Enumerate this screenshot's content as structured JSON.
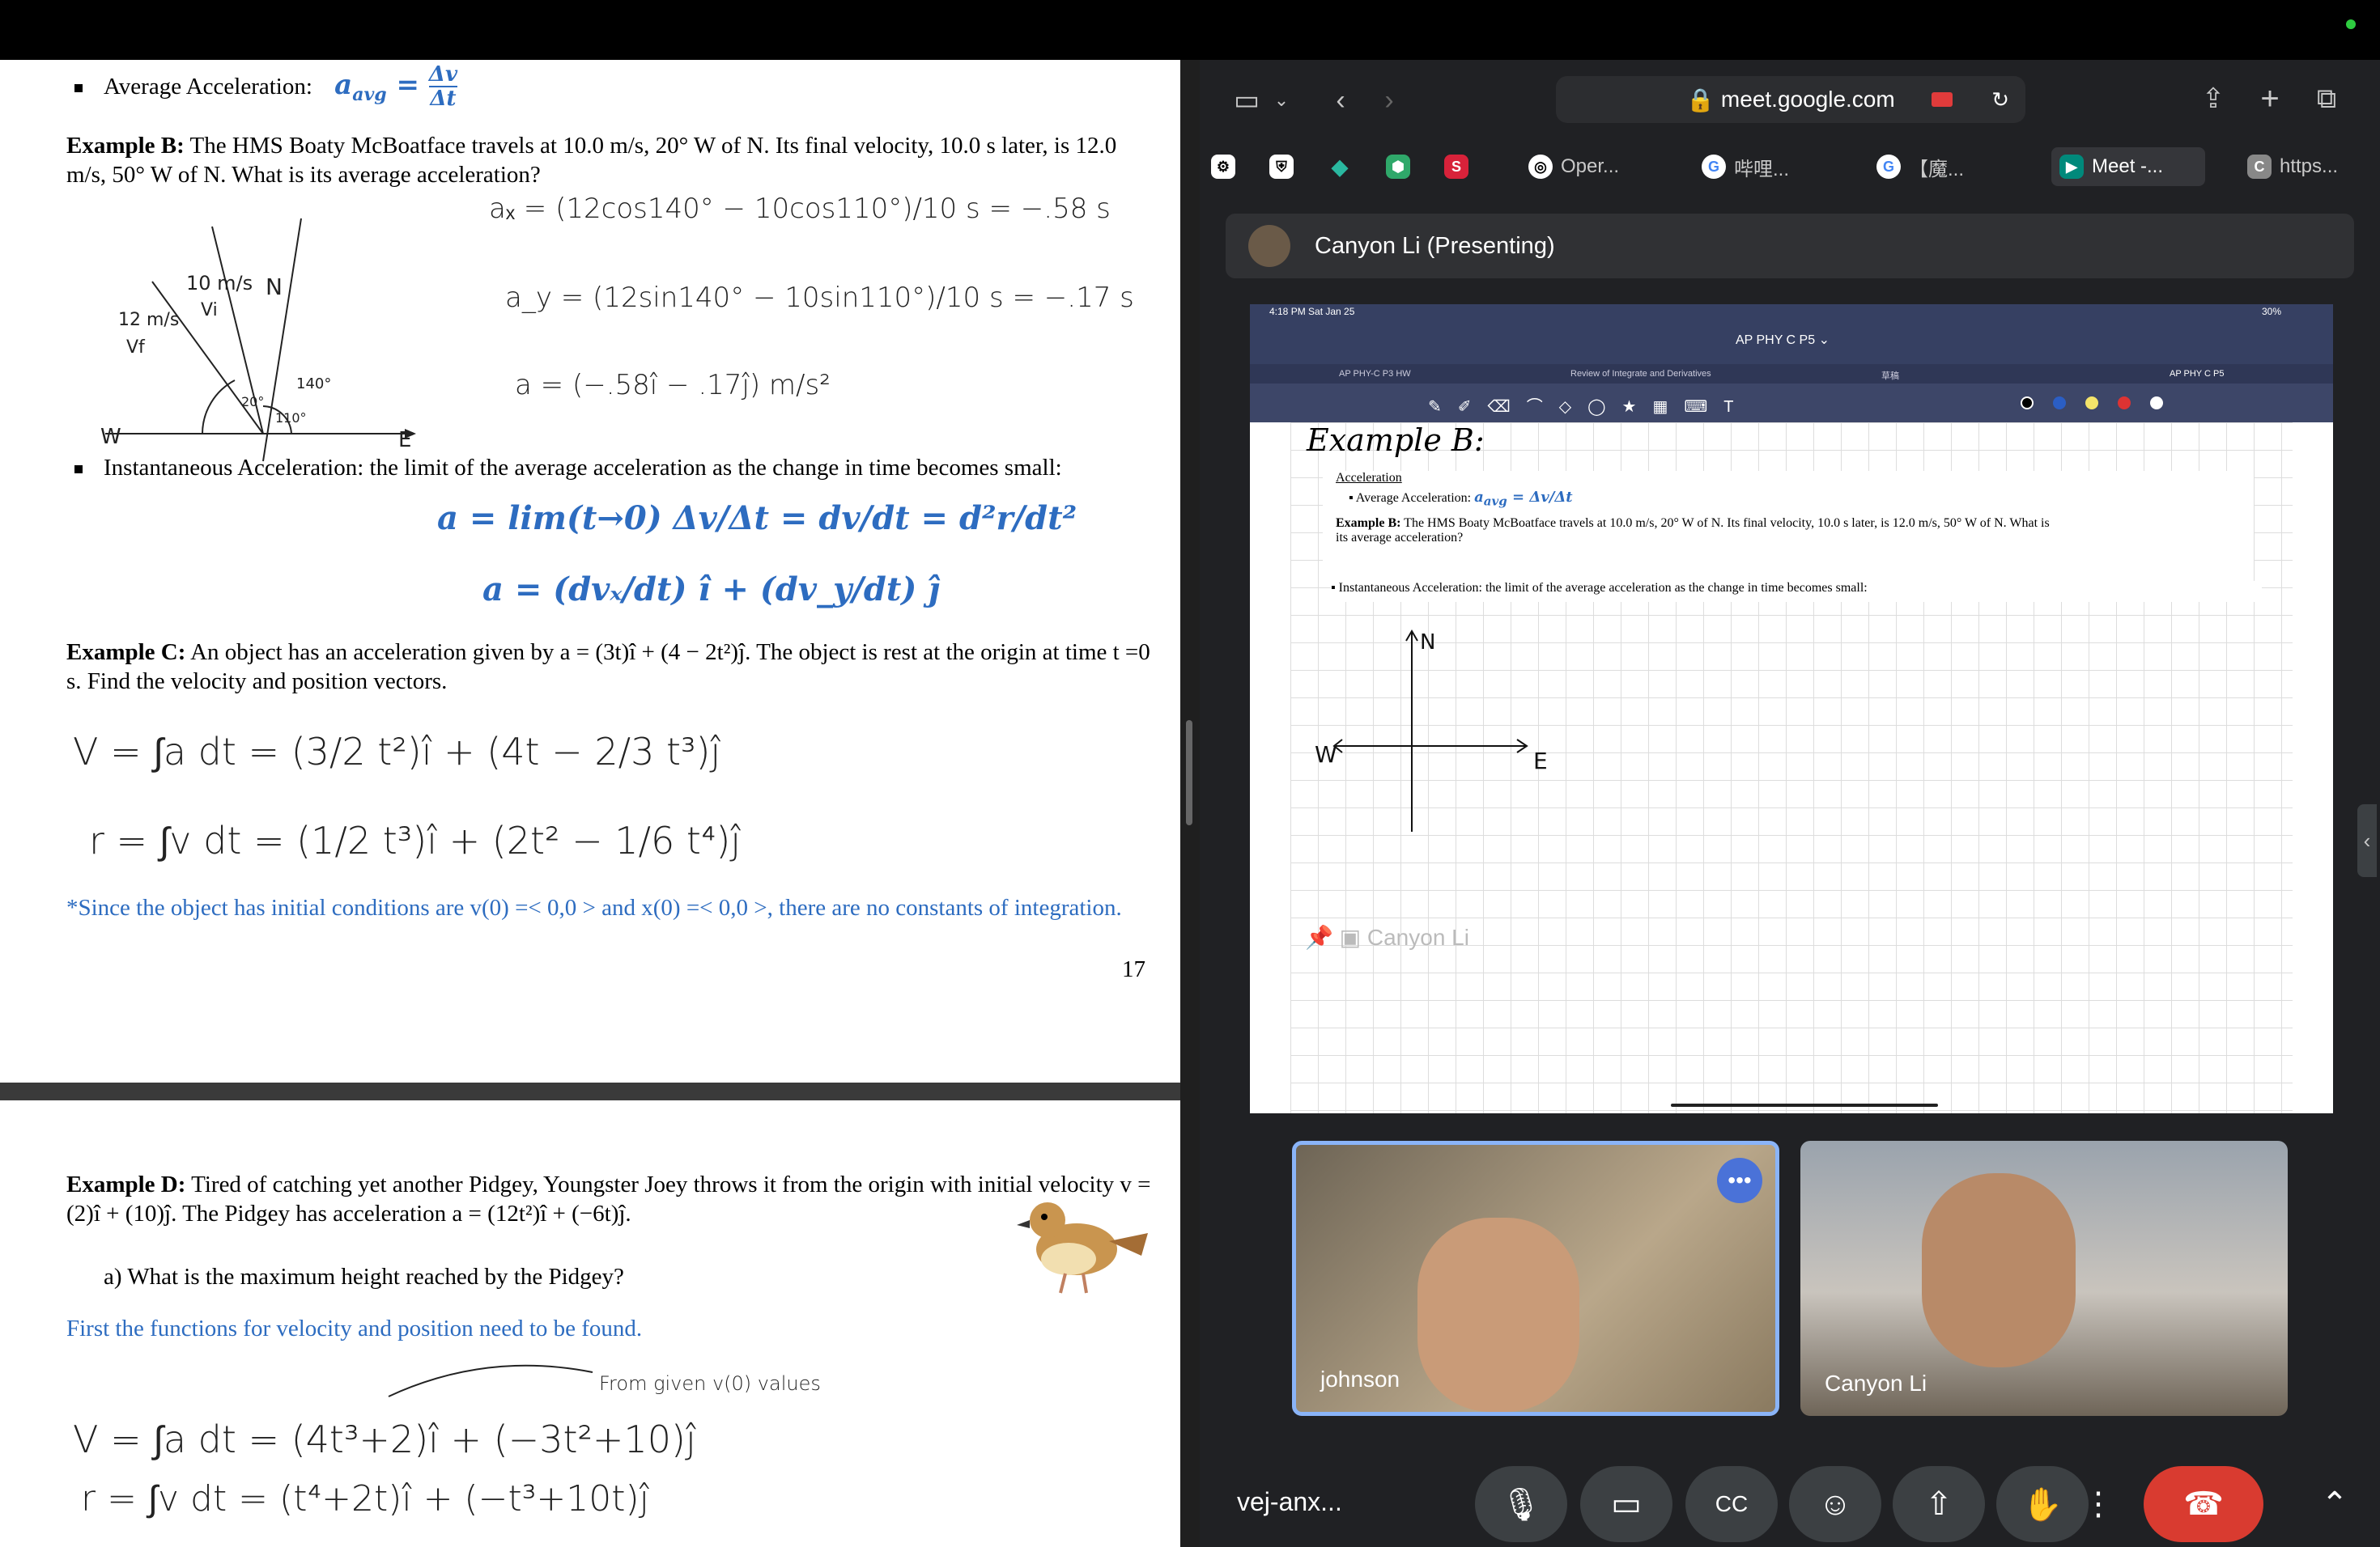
{
  "doc": {
    "avg_label": "Average Acceleration:",
    "avg_formula": "a_avg = Δv/Δt",
    "example_b_label": "Example B:",
    "example_b_text": "The HMS Boaty McBoatface travels at 10.0 m/s, 20° W of N. Its final velocity, 10.0 s later, is 12.0 m/s, 50° W of N. What is its average acceleration?",
    "hand_ax": "aₓ = (12cos140° − 10cos110°)/10 s = −.58 s",
    "hand_ay": "a_y = (12sin140° − 10sin110°)/10 s = −.17 s",
    "hand_a": "a = (−.58î − .17ĵ) m/s²",
    "diagram": {
      "v0": "10 m/s",
      "vi": "Vi",
      "vf_mag": "12 m/s",
      "vf": "Vf",
      "n": "N",
      "w": "W",
      "e": "E",
      "a20": "20°",
      "a110": "110°",
      "a140": "140°"
    },
    "inst_label": "Instantaneous Acceleration: the limit of the average acceleration as the change in time becomes small:",
    "inst_eq1": "a = lim(t→0) Δv/Δt = dv/dt = d²r/dt²",
    "inst_eq2": "a = (dvₓ/dt) î + (dv_y/dt) ĵ",
    "example_c_label": "Example C:",
    "example_c_text": "An object has an acceleration given by a = (3t)î + (4 − 2t²)ĵ. The object is rest at the origin at time t =0 s. Find the velocity and position vectors.",
    "hand_v": "V = ∫a dt = (3/2 t²)î + (4t − 2/3 t³)ĵ",
    "hand_r": "r = ∫v dt = (1/2 t³)î + (2t² − 1/6 t⁴)ĵ",
    "note_c": "*Since the object has initial conditions are v(0) =< 0,0 > and x(0) =< 0,0 >, there are no constants of integration.",
    "page_number": "17",
    "example_d_label": "Example D:",
    "example_d_text": "Tired of catching yet another Pidgey, Youngster Joey throws it from the origin with initial velocity v = (2)î + (10)ĵ. The Pidgey has acceleration a = (12t²)î + (−6t)ĵ.",
    "example_d_a": "a)   What is the maximum height reached by the Pidgey?",
    "example_d_first": "First the functions for velocity and position need to be found.",
    "hand_note": "From given v(0) values",
    "hand_dv": "V = ∫a dt = (4t³+2)î + (−3t²+10)ĵ",
    "hand_dr": "r = ∫v dt = (t⁴+2t)î + (−t³+10t)ĵ"
  },
  "browser": {
    "url": "meet.google.com",
    "tabs": [
      {
        "label": "",
        "icon": "openai-icon"
      },
      {
        "label": "",
        "icon": "shield-icon"
      },
      {
        "label": "",
        "icon": "diamond-icon"
      },
      {
        "label": "",
        "icon": "cube-icon"
      },
      {
        "label": "",
        "icon": "s-icon"
      },
      {
        "label": "Oper...",
        "icon": "o-icon"
      },
      {
        "label": "哔哩...",
        "icon": "google-icon"
      },
      {
        "label": "【魔...",
        "icon": "google-icon"
      },
      {
        "label": "Meet -...",
        "icon": "meet-icon"
      },
      {
        "label": "https...",
        "icon": "c-icon"
      }
    ]
  },
  "meet": {
    "presenter": "Canyon Li (Presenting)",
    "code": "vej-anx...",
    "tiles": [
      {
        "name": "johnson"
      },
      {
        "name": "Canyon Li"
      }
    ],
    "pin_label": "Canyon Li"
  },
  "ipad": {
    "time": "4:18 PM  Sat Jan 25",
    "battery": "30%",
    "title": "AP PHY C P5 ⌄",
    "tabs": [
      "AP PHY-C P3 HW",
      "Review of Integrate and Derivatives",
      "草稿",
      "AP PHY C P5"
    ],
    "hand_title": "Example B:",
    "acc_head": "Acceleration",
    "avg_label": "Average Acceleration:",
    "example_b_label": "Example B:",
    "example_b_text": "The HMS Boaty McBoatface travels at 10.0 m/s, 20° W of N. Its final velocity, 10.0 s later, is 12.0 m/s, 50° W of N. What is its average acceleration?",
    "inst_label": "Instantaneous Acceleration: the limit of the average acceleration as the change in time becomes small:",
    "axis_n": "N",
    "axis_w": "W",
    "axis_e": "E"
  }
}
